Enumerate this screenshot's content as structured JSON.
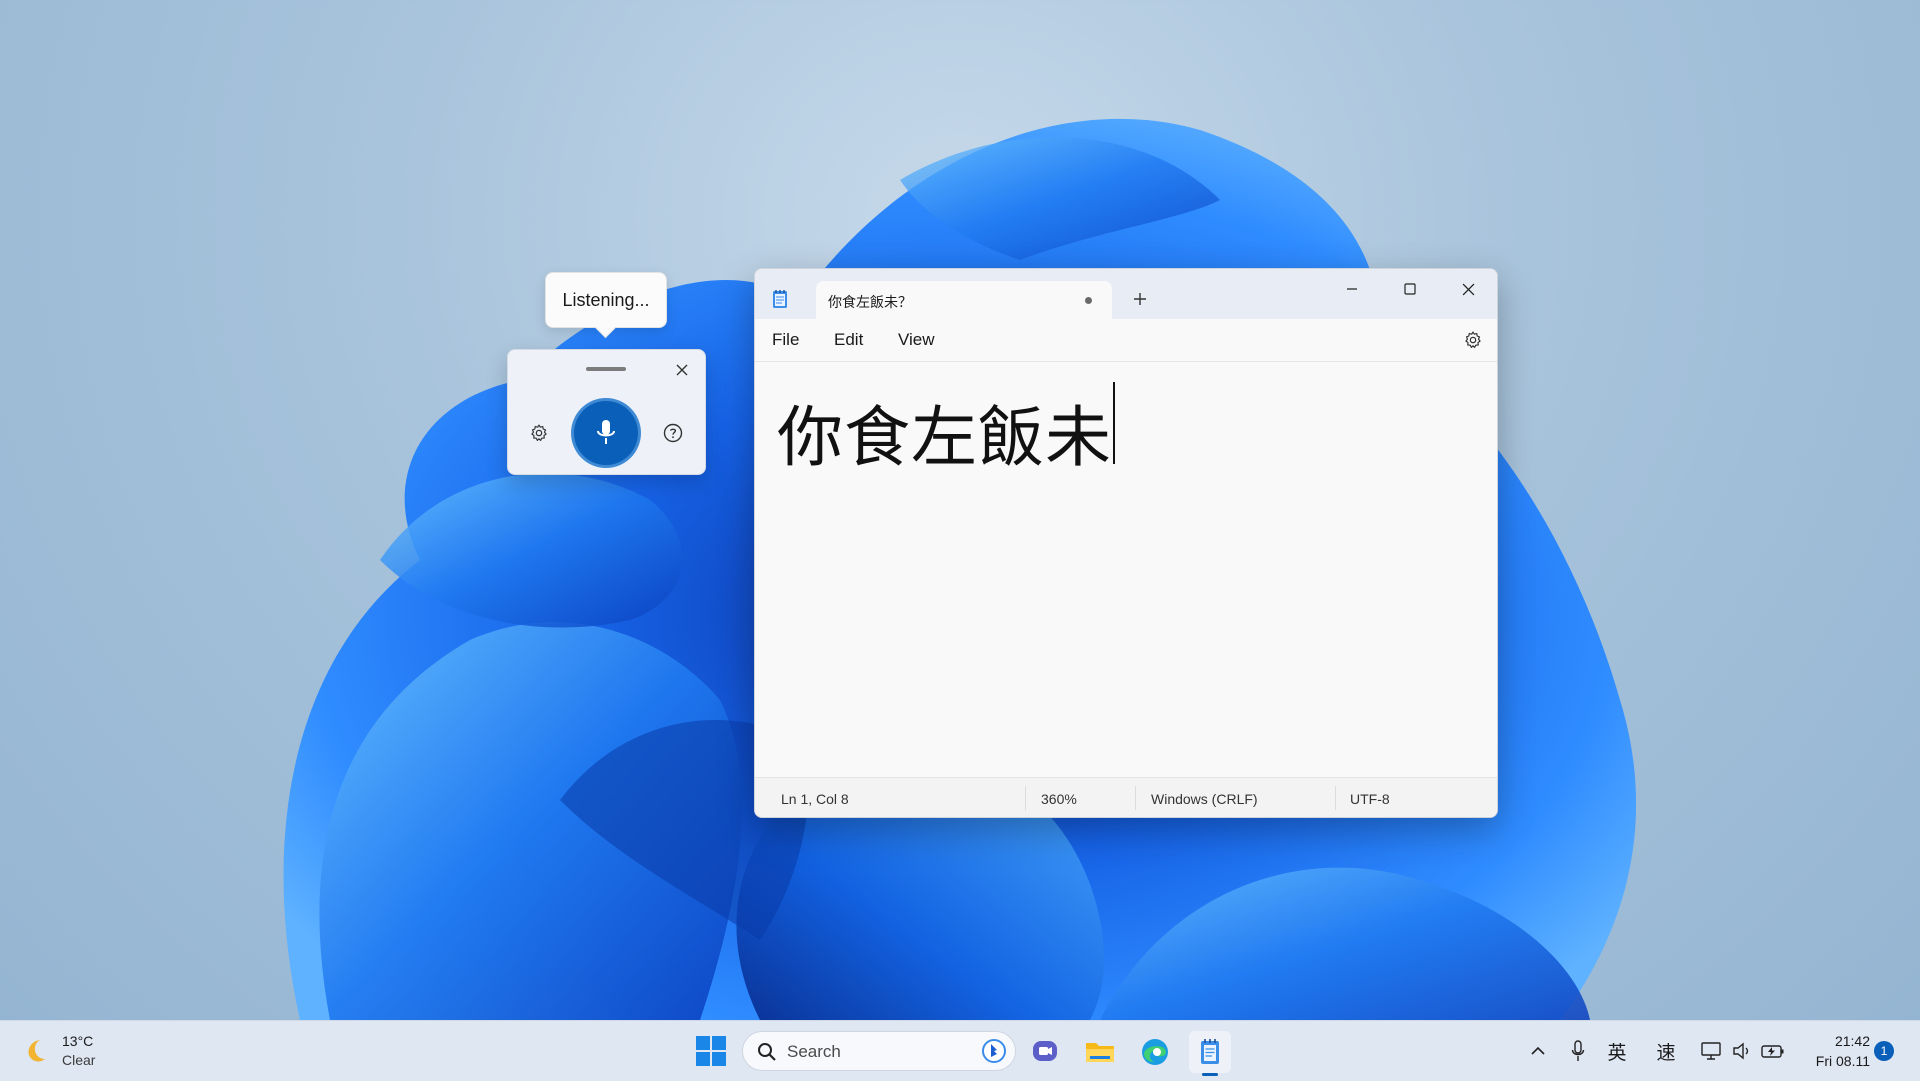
{
  "voice_typing": {
    "tooltip": "Listening...",
    "close_icon": "close-icon",
    "settings_icon": "gear-icon",
    "mic_icon": "microphone-icon",
    "help_icon": "help-circle-icon",
    "accent": "#0a5fb8"
  },
  "notepad": {
    "tab_title": "你食左飯未？",
    "new_tab_icon": "plus-icon",
    "menu": {
      "file": "File",
      "edit": "Edit",
      "view": "View"
    },
    "content": "你食左飯未",
    "status": {
      "position": "Ln 1, Col 8",
      "zoom": "360%",
      "line_endings": "Windows (CRLF)",
      "encoding": "UTF-8"
    }
  },
  "taskbar": {
    "weather": {
      "temp": "13°C",
      "condition": "Clear",
      "icon": "moon-icon"
    },
    "search_label": "Search",
    "tray": {
      "ime_mode": "英",
      "ime_speed": "速"
    },
    "clock": {
      "time": "21:42",
      "date": "Fri 08.11"
    },
    "notification_count": "1",
    "accent": "#0a5fb8"
  }
}
